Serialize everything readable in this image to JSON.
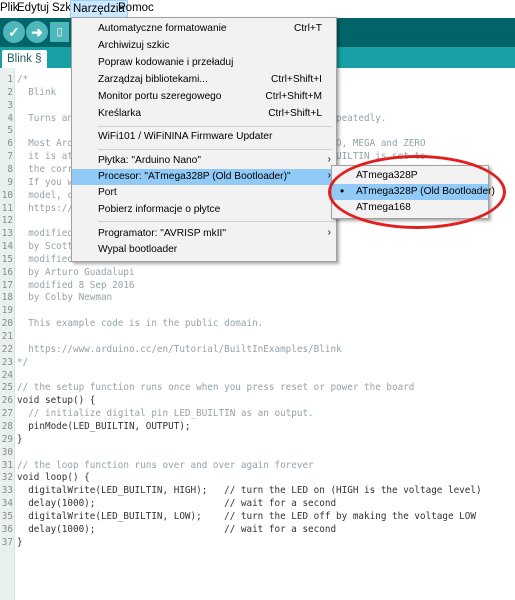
{
  "menubar": {
    "items": [
      "Plik",
      "Edytuj",
      "Szkic",
      "Narzędzia",
      "Pomoc"
    ]
  },
  "toolbar": {
    "buttons": [
      "verify-icon",
      "upload-icon",
      "new-icon",
      "open-icon"
    ]
  },
  "tab": {
    "label": "Blink §"
  },
  "colors": {
    "toolbar": "#006468",
    "tabbar": "#17a1a5",
    "highlight": "#91c9f7",
    "annotation": "#e0201e"
  },
  "code": [
    {
      "n": "1",
      "t": "/*"
    },
    {
      "n": "2",
      "t": "  Blink"
    },
    {
      "n": "3",
      "t": ""
    },
    {
      "n": "4",
      "t": "  Turns an                                             repeatedly."
    },
    {
      "n": "5",
      "t": ""
    },
    {
      "n": "6",
      "t": "  Most Ard                                             UNO, MEGA and ZERO"
    },
    {
      "n": "7",
      "t": "  it is at                                             _BUILTIN is set to"
    },
    {
      "n": "8",
      "t": "  the corre"
    },
    {
      "n": "9",
      "t": "  If you w"
    },
    {
      "n": "10",
      "t": "  model, ch"
    },
    {
      "n": "11",
      "t": "  https://w"
    },
    {
      "n": "12",
      "t": ""
    },
    {
      "n": "13",
      "t": "  modified"
    },
    {
      "n": "14",
      "t": "  by Scott"
    },
    {
      "n": "15",
      "t": "  modified"
    },
    {
      "n": "16",
      "t": "  by Arturo Guadalupi"
    },
    {
      "n": "17",
      "t": "  modified 8 Sep 2016"
    },
    {
      "n": "18",
      "t": "  by Colby Newman"
    },
    {
      "n": "19",
      "t": ""
    },
    {
      "n": "20",
      "t": "  This example code is in the public domain."
    },
    {
      "n": "21",
      "t": ""
    },
    {
      "n": "22",
      "t": "  https://www.arduino.cc/en/Tutorial/BuiltInExamples/Blink"
    },
    {
      "n": "23",
      "t": "*/"
    },
    {
      "n": "24",
      "t": ""
    },
    {
      "n": "25",
      "t": "// the setup function runs once when you press reset or power the board"
    },
    {
      "n": "26",
      "t": "void setup() {"
    },
    {
      "n": "27",
      "t": "  // initialize digital pin LED_BUILTIN as an output."
    },
    {
      "n": "28",
      "t": "  pinMode(LED_BUILTIN, OUTPUT);"
    },
    {
      "n": "29",
      "t": "}"
    },
    {
      "n": "30",
      "t": ""
    },
    {
      "n": "31",
      "t": "// the loop function runs over and over again forever"
    },
    {
      "n": "32",
      "t": "void loop() {"
    },
    {
      "n": "33",
      "t": "  digitalWrite(LED_BUILTIN, HIGH);   // turn the LED on (HIGH is the voltage level)"
    },
    {
      "n": "34",
      "t": "  delay(1000);                       // wait for a second"
    },
    {
      "n": "35",
      "t": "  digitalWrite(LED_BUILTIN, LOW);    // turn the LED off by making the voltage LOW"
    },
    {
      "n": "36",
      "t": "  delay(1000);                       // wait for a second"
    },
    {
      "n": "37",
      "t": "}"
    }
  ],
  "menu": {
    "items": [
      {
        "label": "Automatyczne formatowanie",
        "shortcut": "Ctrl+T"
      },
      {
        "label": "Archiwizuj szkic",
        "shortcut": ""
      },
      {
        "label": "Popraw kodowanie i przeładuj",
        "shortcut": ""
      },
      {
        "label": "Zarządzaj bibliotekami...",
        "shortcut": "Ctrl+Shift+I"
      },
      {
        "label": "Monitor portu szeregowego",
        "shortcut": "Ctrl+Shift+M"
      },
      {
        "label": "Kreślarka",
        "shortcut": "Ctrl+Shift+L"
      },
      {
        "label": "WiFi101 / WiFiNINA Firmware Updater",
        "shortcut": ""
      },
      {
        "label": "Płytka: \"Arduino Nano\"",
        "shortcut": ""
      },
      {
        "label": "Procesor: \"ATmega328P (Old Bootloader)\"",
        "shortcut": ""
      },
      {
        "label": "Port",
        "shortcut": ""
      },
      {
        "label": "Pobierz informacje o płytce",
        "shortcut": ""
      },
      {
        "label": "Programator: \"AVRISP mkII\"",
        "shortcut": ""
      },
      {
        "label": "Wypal bootloader",
        "shortcut": ""
      }
    ]
  },
  "submenu": {
    "items": [
      {
        "label": "ATmega328P",
        "selected": false
      },
      {
        "label": "ATmega328P (Old Bootloader)",
        "selected": true
      },
      {
        "label": "ATmega168",
        "selected": false
      }
    ]
  }
}
